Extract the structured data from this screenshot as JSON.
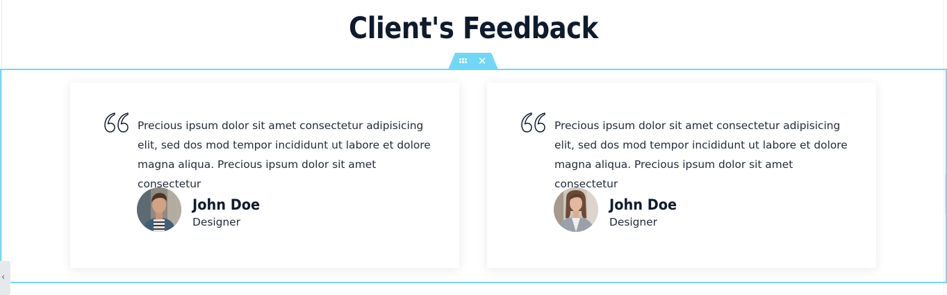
{
  "section": {
    "title": "Client's Feedback"
  },
  "editor": {
    "drag_icon": "drag-handle-icon",
    "close_icon": "close-icon",
    "close_glyph": "✕",
    "panel_toggle_glyph": "‹",
    "accent_color": "#71d7f7"
  },
  "testimonials": [
    {
      "quote": "Precious ipsum dolor sit amet consectetur adipisicing elit, sed dos mod tempor incididunt ut labore et dolore magna aliqua. Precious ipsum dolor sit amet consectetur",
      "name": "John Doe",
      "role": "Designer",
      "avatar_icon": "avatar-man-photo"
    },
    {
      "quote": "Precious ipsum dolor sit amet consectetur adipisicing elit, sed dos mod tempor incididunt ut labore et dolore magna aliqua. Precious ipsum dolor sit amet consectetur",
      "name": "John Doe",
      "role": "Designer",
      "avatar_icon": "avatar-woman-photo"
    }
  ]
}
